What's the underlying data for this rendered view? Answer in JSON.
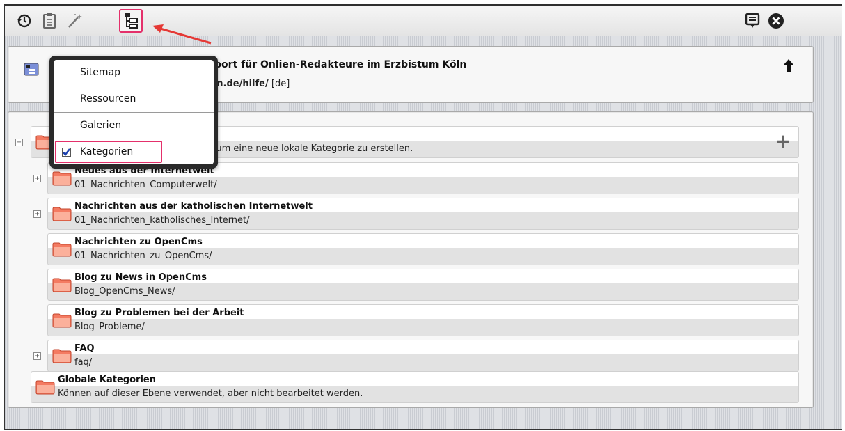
{
  "toolbar": {
    "icons": [
      "history-icon",
      "clipboard-icon",
      "magic-wand-icon",
      "sitemap-icon"
    ],
    "right_icons": [
      "publish-list-icon",
      "close-icon"
    ]
  },
  "site": {
    "title_visible": "pport für Onlien-Redakteure im Erzbistum Köln",
    "path_bold": "eln.de/hilfe/",
    "path_lang": "[de]"
  },
  "dropdown": {
    "items": [
      {
        "label": "Sitemap",
        "checked": false
      },
      {
        "label": "Ressourcen",
        "checked": false
      },
      {
        "label": "Galerien",
        "checked": false
      },
      {
        "label": "Kategorien",
        "checked": true
      }
    ]
  },
  "tree": {
    "root_hint": "echts um eine neue lokale Kategorie zu erstellen.",
    "add_label": "+",
    "items": [
      {
        "title": "Neues aus der Internetwelt",
        "path": "01_Nachrichten_Computerwelt/",
        "expandable": true
      },
      {
        "title": "Nachrichten aus der katholischen Internetwelt",
        "path": "01_Nachrichten_katholisches_Internet/",
        "expandable": true
      },
      {
        "title": "Nachrichten zu OpenCms",
        "path": "01_Nachrichten_zu_OpenCms/",
        "expandable": false
      },
      {
        "title": "Blog zu News in OpenCms",
        "path": "Blog_OpenCms_News/",
        "expandable": false
      },
      {
        "title": "Blog zu Problemen bei der Arbeit",
        "path": "Blog_Probleme/",
        "expandable": false
      },
      {
        "title": "FAQ",
        "path": "faq/",
        "expandable": true
      }
    ],
    "global": {
      "title": "Globale Kategorien",
      "description": "Können auf dieser Ebene verwendet, aber nicht bearbeitet werden."
    }
  },
  "colors": {
    "highlight": "#e4306b",
    "arrow": "#e53935",
    "folder": "#f47b62"
  }
}
